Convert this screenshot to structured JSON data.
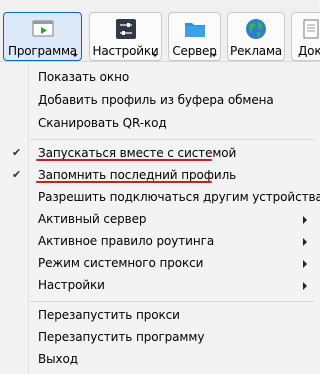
{
  "toolbar": {
    "buttons": [
      {
        "label": "Программа",
        "icon": "play-screen-icon",
        "dropdown": true,
        "active": true
      },
      {
        "label": "Настройки",
        "icon": "sliders-icon",
        "dropdown": true,
        "active": false
      },
      {
        "label": "Сервер",
        "icon": "server-folder-icon",
        "dropdown": true,
        "active": false
      },
      {
        "label": "Реклама",
        "icon": "globe-icon",
        "dropdown": false,
        "active": false
      },
      {
        "label": "Док",
        "icon": "document-icon",
        "dropdown": false,
        "active": false
      }
    ]
  },
  "menu": {
    "items": [
      {
        "label": "Показать окно"
      },
      {
        "label": "Добавить профиль из буфера обмена"
      },
      {
        "label": "Сканировать QR-код"
      },
      {
        "label": "Запускаться вместе с системой",
        "checked": true
      },
      {
        "label": "Запомнить последний профиль",
        "checked": true
      },
      {
        "label": "Разрешить подключаться другим устройствам"
      },
      {
        "label": "Активный сервер",
        "submenu": true
      },
      {
        "label": "Активное правило роутинга",
        "submenu": true
      },
      {
        "label": "Режим системного прокси",
        "submenu": true
      },
      {
        "label": "Настройки",
        "submenu": true
      },
      {
        "label": "Перезапустить прокси"
      },
      {
        "label": "Перезапустить программу"
      },
      {
        "label": "Выход"
      }
    ]
  },
  "colors": {
    "accent": "#0a64c8",
    "underline_annotation": "#d61a1a"
  }
}
